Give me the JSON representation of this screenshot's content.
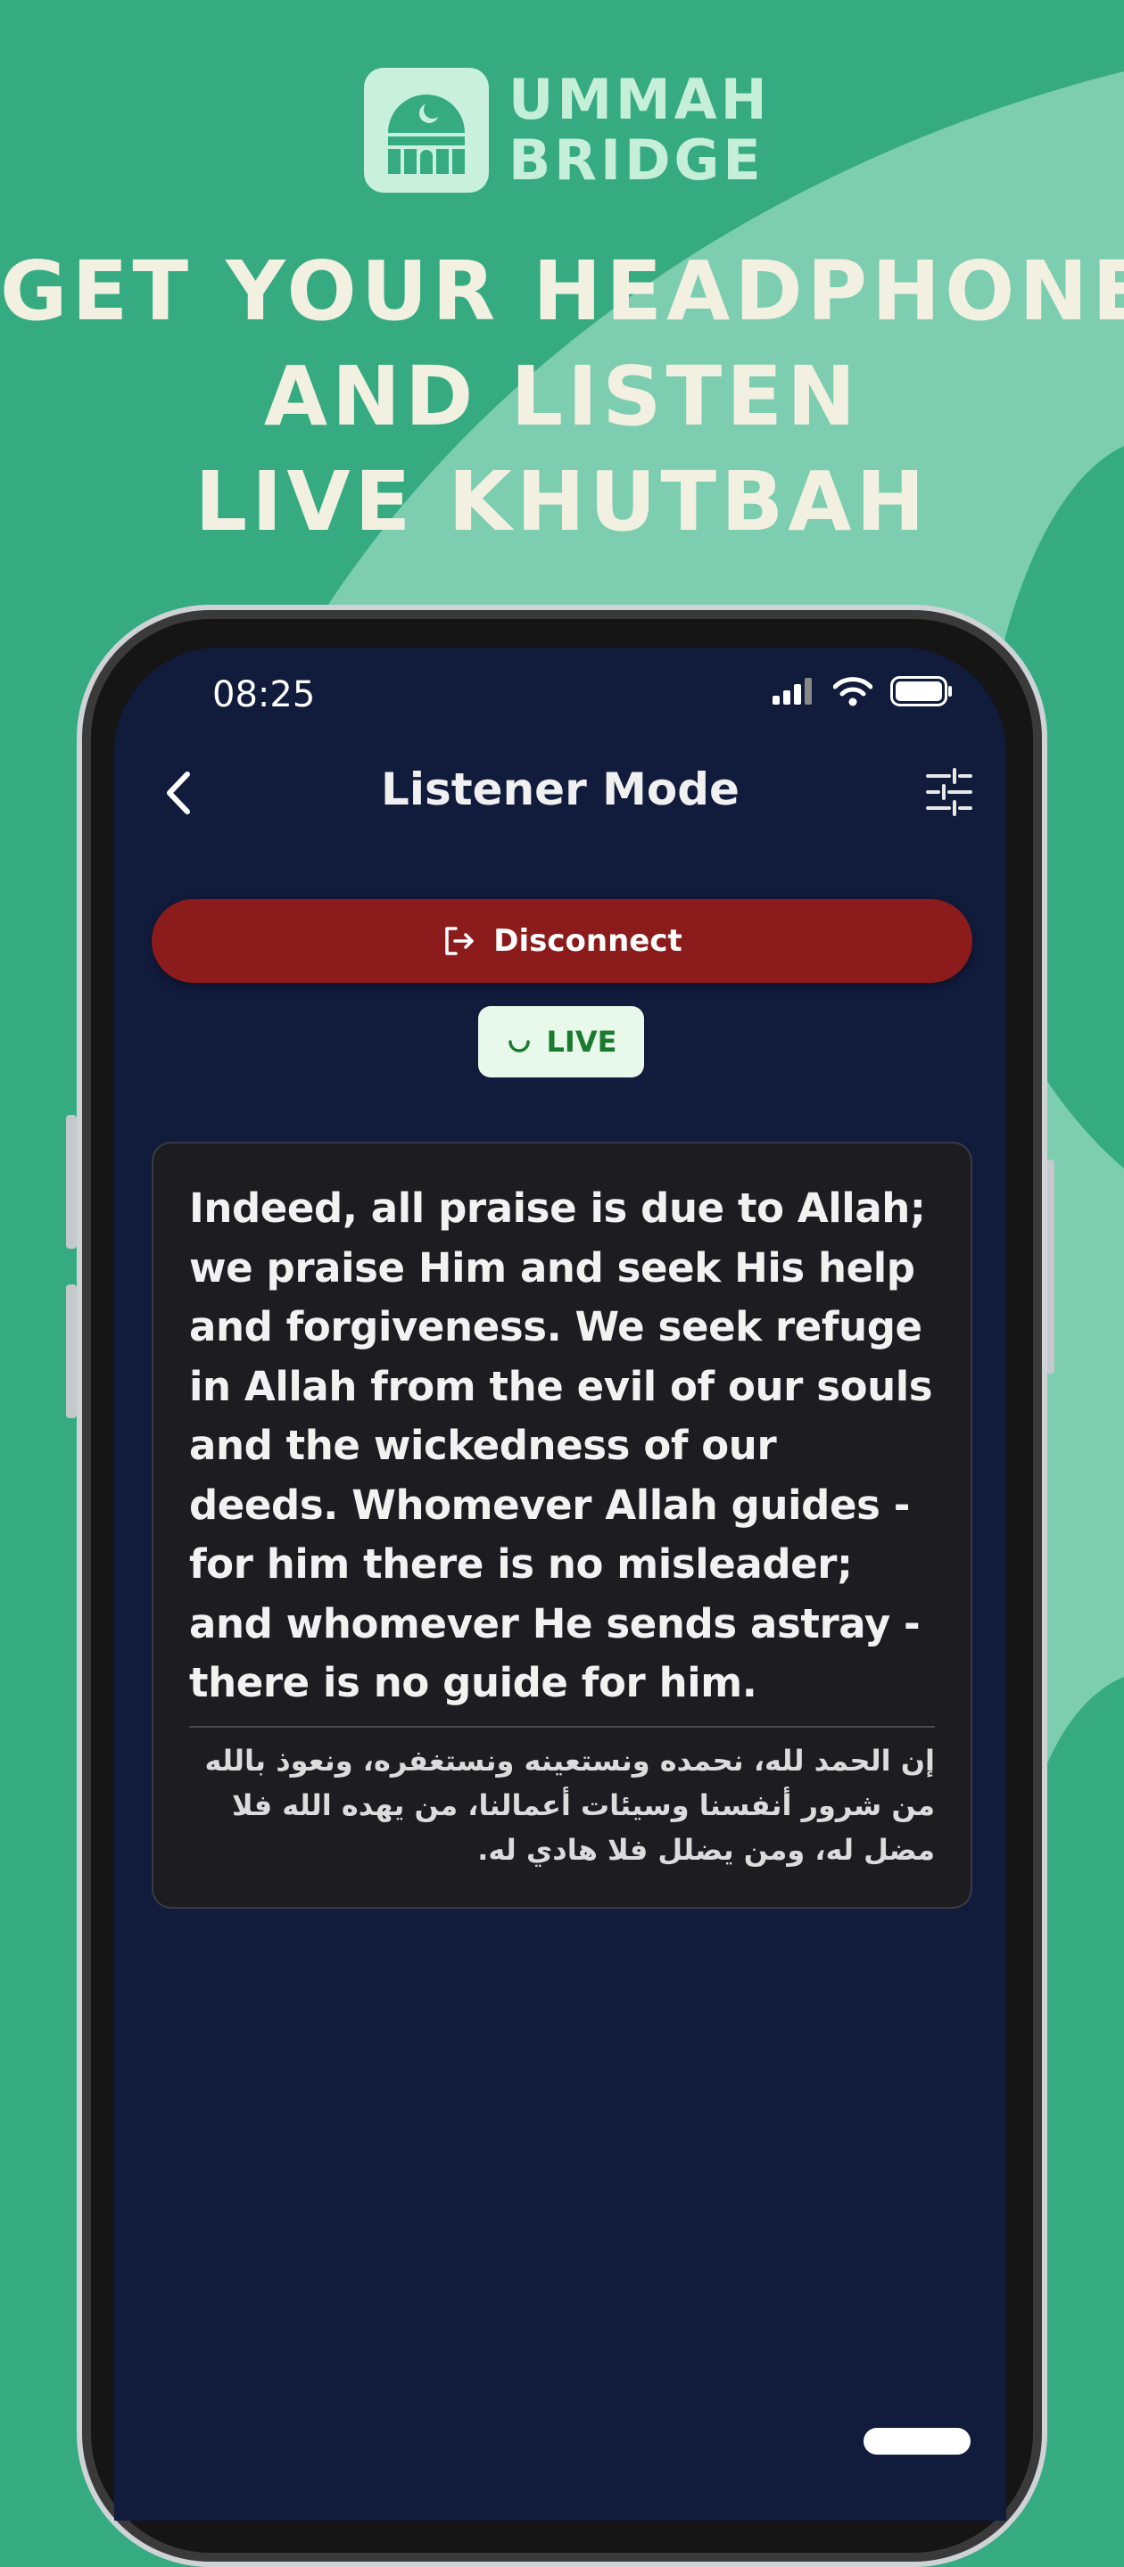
{
  "brand": {
    "line1": "UMMAH",
    "line2": "BRIDGE",
    "icon": "mosque-icon"
  },
  "headline": {
    "line1": "GET YOUR HEADPHONE",
    "line2": "AND LISTEN",
    "line3": "LIVE KHUTBAH"
  },
  "status_bar": {
    "time": "08:25",
    "icons": [
      "signal-icon",
      "wifi-icon",
      "battery-icon"
    ]
  },
  "header": {
    "title": "Listener Mode",
    "back_icon": "chevron-left-icon",
    "settings_icon": "sliders-icon"
  },
  "actions": {
    "disconnect_label": "Disconnect",
    "disconnect_icon": "logout-icon"
  },
  "live": {
    "label": "LIVE",
    "icon": "spinner-icon"
  },
  "transcript": {
    "english": "Indeed, all praise is due to Allah; we praise Him and seek His help and forgiveness. We seek refuge in Allah from the evil of our souls and the wickedness of our deeds. Whomever Allah guides - for him there is no misleader; and whomever He sends astray - there is no guide for him.",
    "arabic": "إن الحمد لله، نحمده ونستعينه ونستغفره، ونعوذ بالله من شرور أنفسنا وسيئات أعمالنا، من يهده الله فلا مضل له، ومن يضلل فلا هادي له."
  },
  "colors": {
    "background": "#36ab82",
    "screen": "#111b3c",
    "disconnect": "#8c1c1c",
    "live_bg": "#e8f8ea",
    "live_text": "#1a7a2e"
  }
}
